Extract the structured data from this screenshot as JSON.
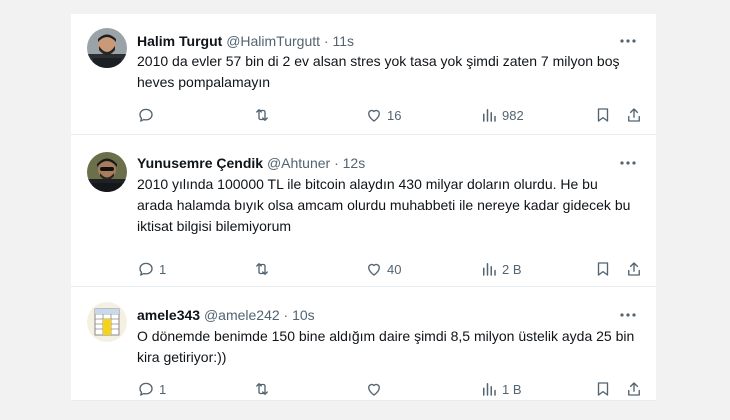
{
  "tweets": [
    {
      "name": "Halim Turgut",
      "handle": "@HalimTurgutt",
      "dot": "·",
      "time": "11s",
      "text": "2010 da evler 57 bin di  2 ev alsan stres yok tasa yok  şimdi zaten 7 milyon boş heves pompalamayın",
      "replies": "",
      "retweets": "",
      "likes": "16",
      "views": "982"
    },
    {
      "name": "Yunusemre Çendik",
      "handle": "@Ahtuner",
      "dot": "·",
      "time": "12s",
      "text": "2010 yılında 100000 TL ile bitcoin alaydın 430 milyar doların olurdu. He bu arada halamda bıyık olsa amcam olurdu muhabbeti ile nereye kadar gidecek bu iktisat bilgisi bilemiyorum",
      "replies": "1",
      "retweets": "",
      "likes": "40",
      "views": "2 B"
    },
    {
      "name": "amele343",
      "handle": "@amele242",
      "dot": "·",
      "time": "10s",
      "text": "O dönemde benimde 150 bine aldığım daire şimdi 8,5 milyon üstelik ayda 25 bin kira getiriyor:))",
      "replies": "1",
      "retweets": "",
      "likes": "",
      "views": "1 B"
    }
  ],
  "icons": {
    "more": "more-icon",
    "reply": "reply-icon",
    "retweet": "retweet-icon",
    "like": "heart-icon",
    "views": "views-icon",
    "bookmark": "bookmark-icon",
    "share": "share-icon"
  },
  "colors": {
    "text": "#0f1419",
    "secondary": "#536471",
    "divider": "#e6ecf0",
    "background": "#f2f2f2"
  }
}
